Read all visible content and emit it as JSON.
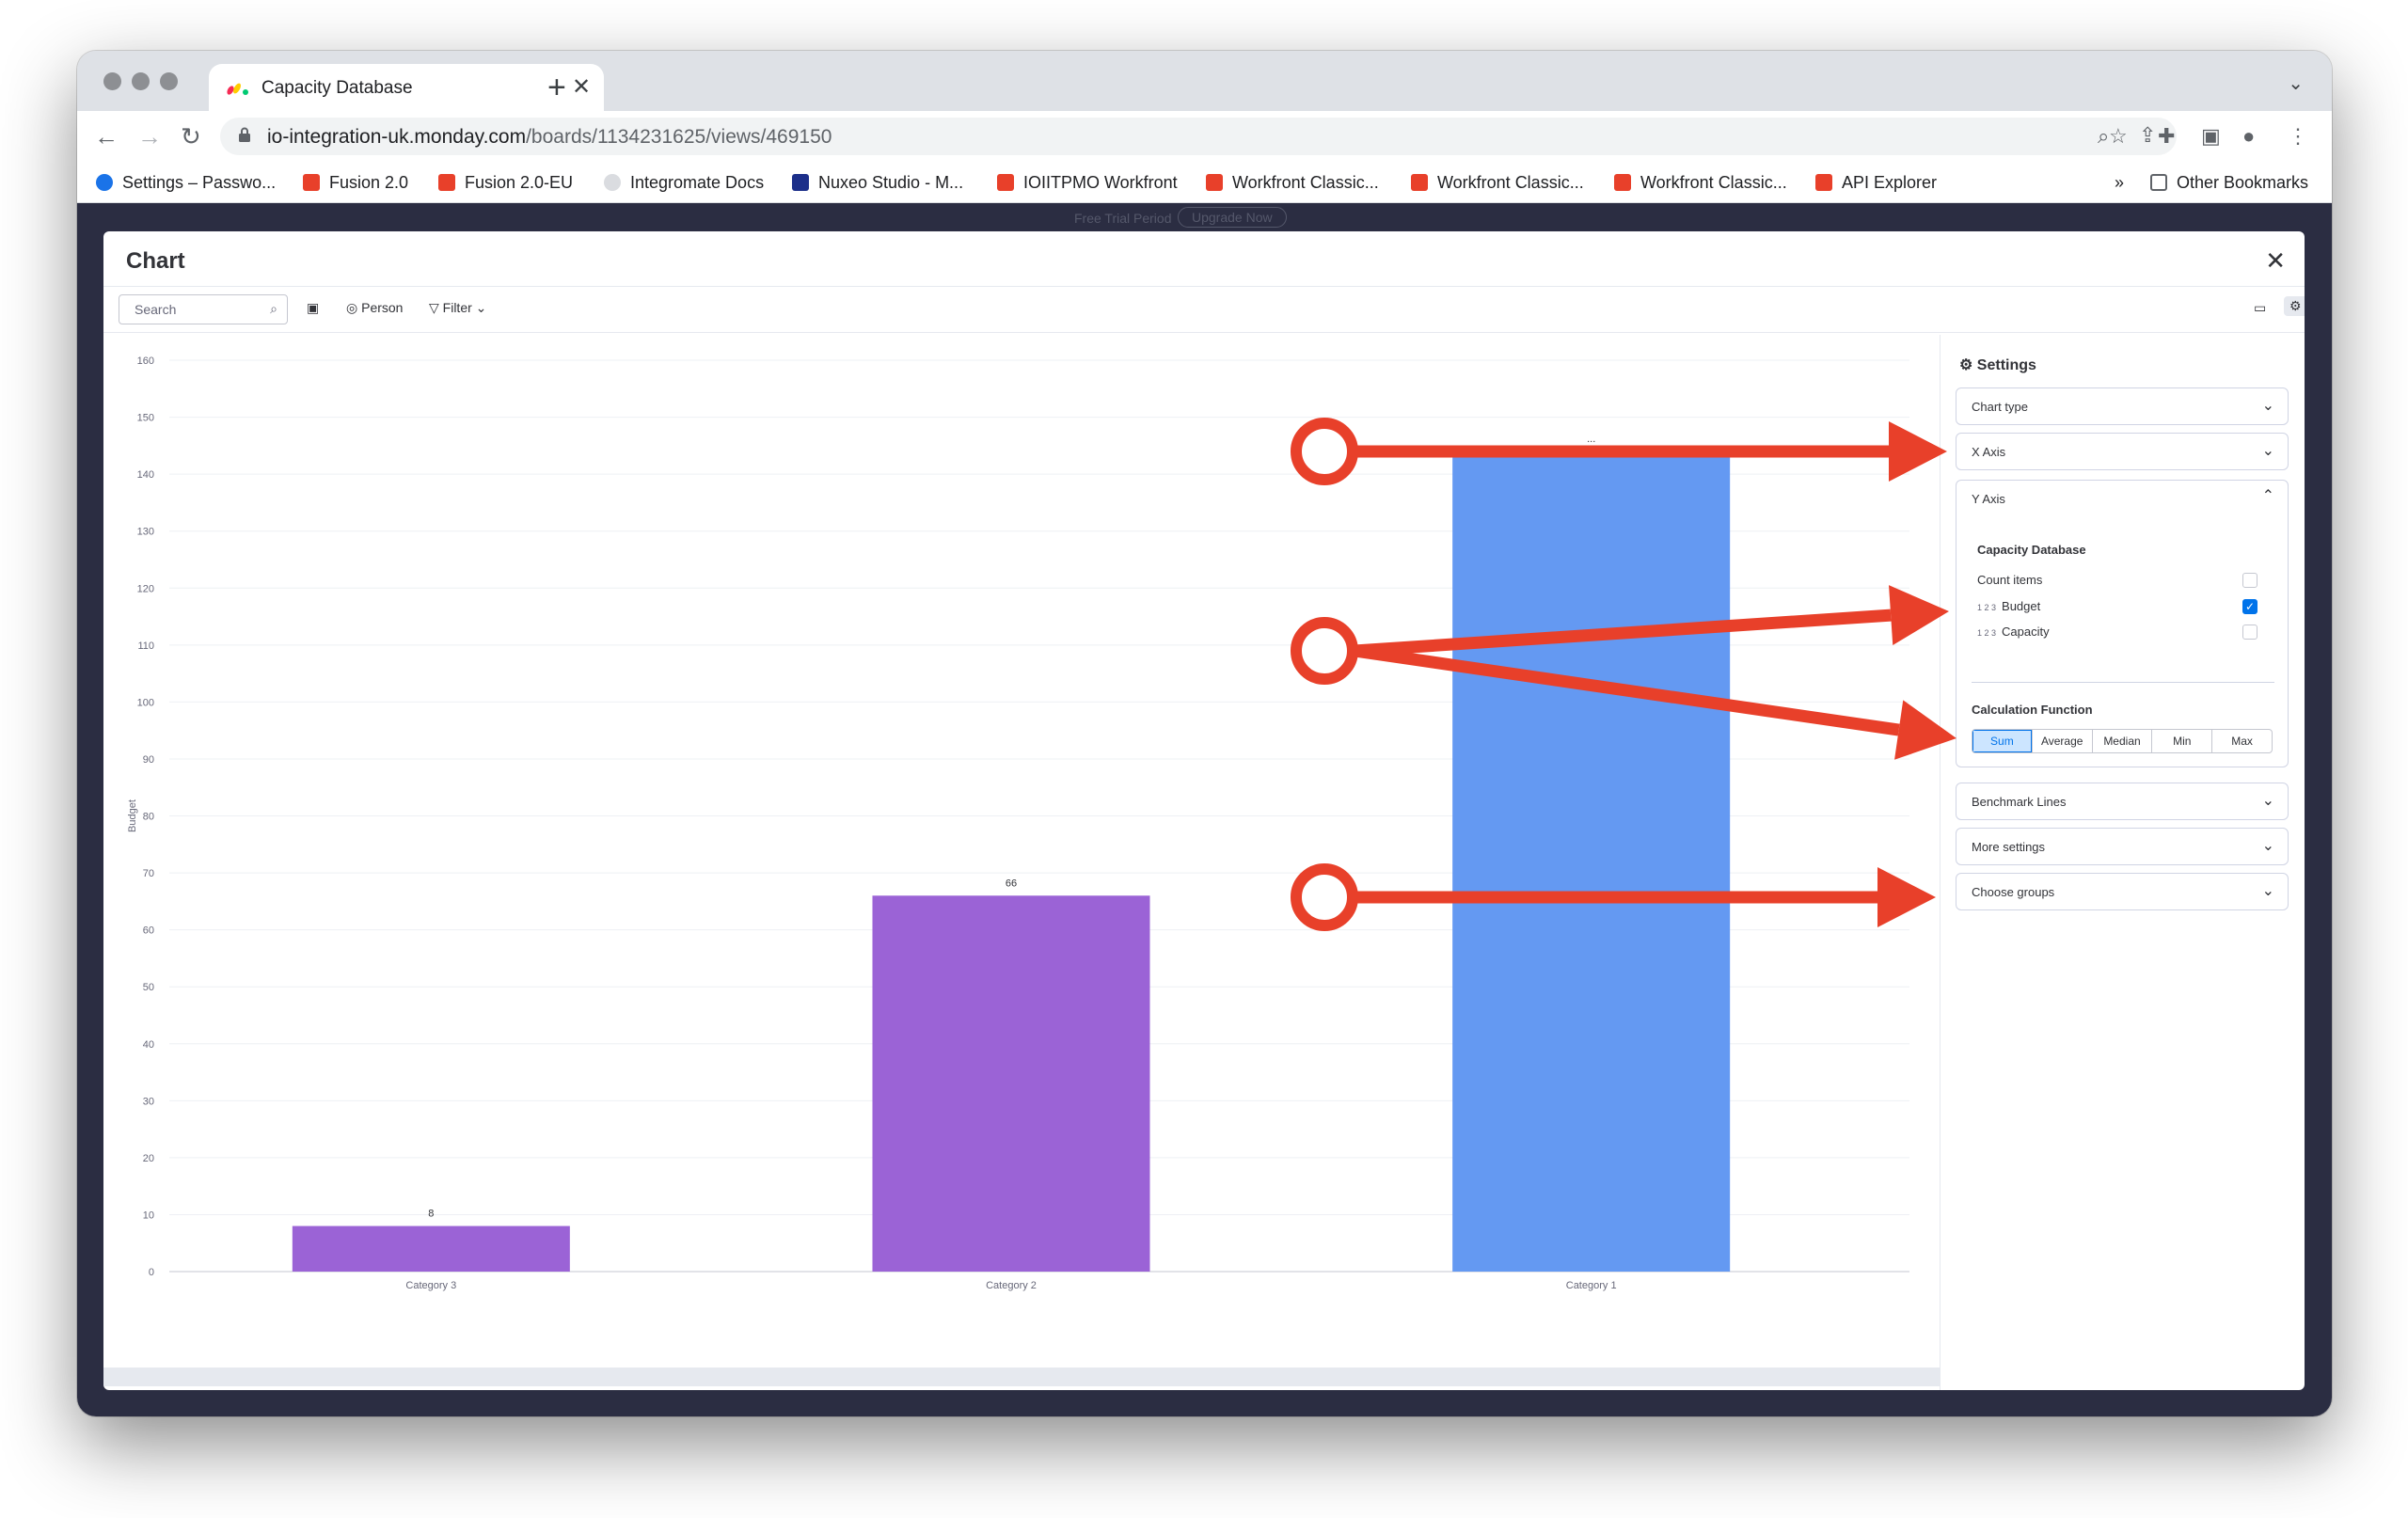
{
  "browser": {
    "tab_title": "Capacity Database",
    "url_host": "io-integration-uk.monday.com",
    "url_path": "/boards/1134231625/views/469150",
    "bookmarks": [
      "Settings – Passwo...",
      "Fusion 2.0",
      "Fusion 2.0-EU",
      "Integromate Docs",
      "Nuxeo Studio - M...",
      "IOIITPMO Workfront",
      "Workfront Classic...",
      "Workfront Classic...",
      "Workfront Classic...",
      "API Explorer"
    ],
    "bookmarks_overflow": "»",
    "other_bookmarks": "Other Bookmarks"
  },
  "banner": {
    "trial_text": "Free Trial Period",
    "upgrade_label": "Upgrade Now"
  },
  "modal": {
    "title": "Chart",
    "search_placeholder": "Search",
    "person_label": "Person",
    "filter_label": "Filter"
  },
  "settings": {
    "title": "Settings",
    "chart_type": "Chart type",
    "x_axis": "X Axis",
    "y_axis": "Y Axis",
    "board_name": "Capacity Database",
    "count_items": "Count items",
    "budget": "Budget",
    "capacity": "Capacity",
    "number_prefix": "1 2 3",
    "calc_heading": "Calculation Function",
    "calc_options": [
      "Sum",
      "Average",
      "Median",
      "Min",
      "Max"
    ],
    "calc_selected": "Sum",
    "benchmark": "Benchmark Lines",
    "more_settings": "More settings",
    "choose_groups": "Choose groups",
    "checked": {
      "count_items": false,
      "budget": true,
      "capacity": false
    }
  },
  "chart_data": {
    "type": "bar",
    "ylabel": "Budget",
    "ylim": [
      0,
      160
    ],
    "yticks": [
      0,
      10,
      20,
      30,
      40,
      50,
      60,
      70,
      80,
      90,
      100,
      110,
      120,
      130,
      140,
      150,
      160
    ],
    "categories": [
      "Category 3",
      "Category 2",
      "Category 1"
    ],
    "values": [
      8,
      66,
      144
    ],
    "data_labels": [
      "8",
      "66",
      "..."
    ],
    "colors": [
      "#9b63d6",
      "#9b63d6",
      "#6499f2"
    ],
    "grid": true
  },
  "colors": {
    "accent": "#0073ea",
    "annotation": "#e8402a"
  }
}
